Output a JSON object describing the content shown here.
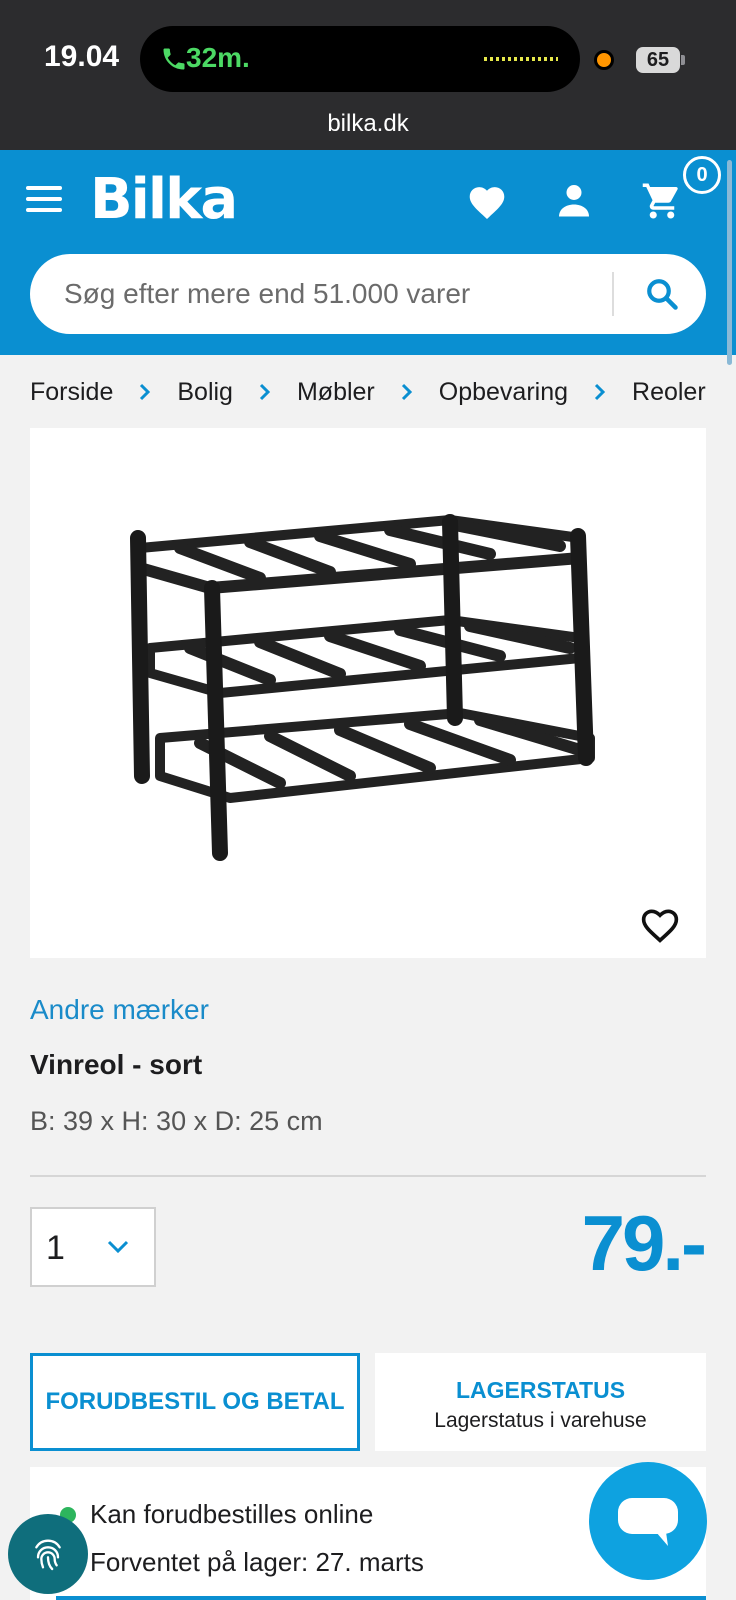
{
  "status_bar": {
    "time": "19.04",
    "call_duration": "32m.",
    "battery": "65",
    "url": "bilka.dk"
  },
  "header": {
    "logo": "Bilka",
    "cart_count": "0",
    "search_placeholder": "Søg efter mere end 51.000 varer",
    "icons": [
      "menu-icon",
      "heart-icon",
      "user-icon",
      "cart-icon",
      "search-icon"
    ]
  },
  "breadcrumb": [
    "Forside",
    "Bolig",
    "Møbler",
    "Opbevaring",
    "Reoler"
  ],
  "product": {
    "brand": "Andre mærker",
    "title": "Vinreol - sort",
    "dimensions": "B: 39 x H: 30 x D: 25 cm",
    "quantity": "1",
    "price": "79.-"
  },
  "actions": {
    "preorder_label": "FORUDBESTIL OG BETAL",
    "stock_title": "LAGERSTATUS",
    "stock_subtitle": "Lagerstatus i varehuse"
  },
  "availability": {
    "online": "Kan forudbestilles online",
    "expected": "Forventet på lager: 27. marts"
  },
  "colors": {
    "brand_blue": "#0a8fd1",
    "link_blue": "#1a8bc9",
    "status_green": "#2db55d",
    "chat_blue": "#0ea2e0"
  }
}
